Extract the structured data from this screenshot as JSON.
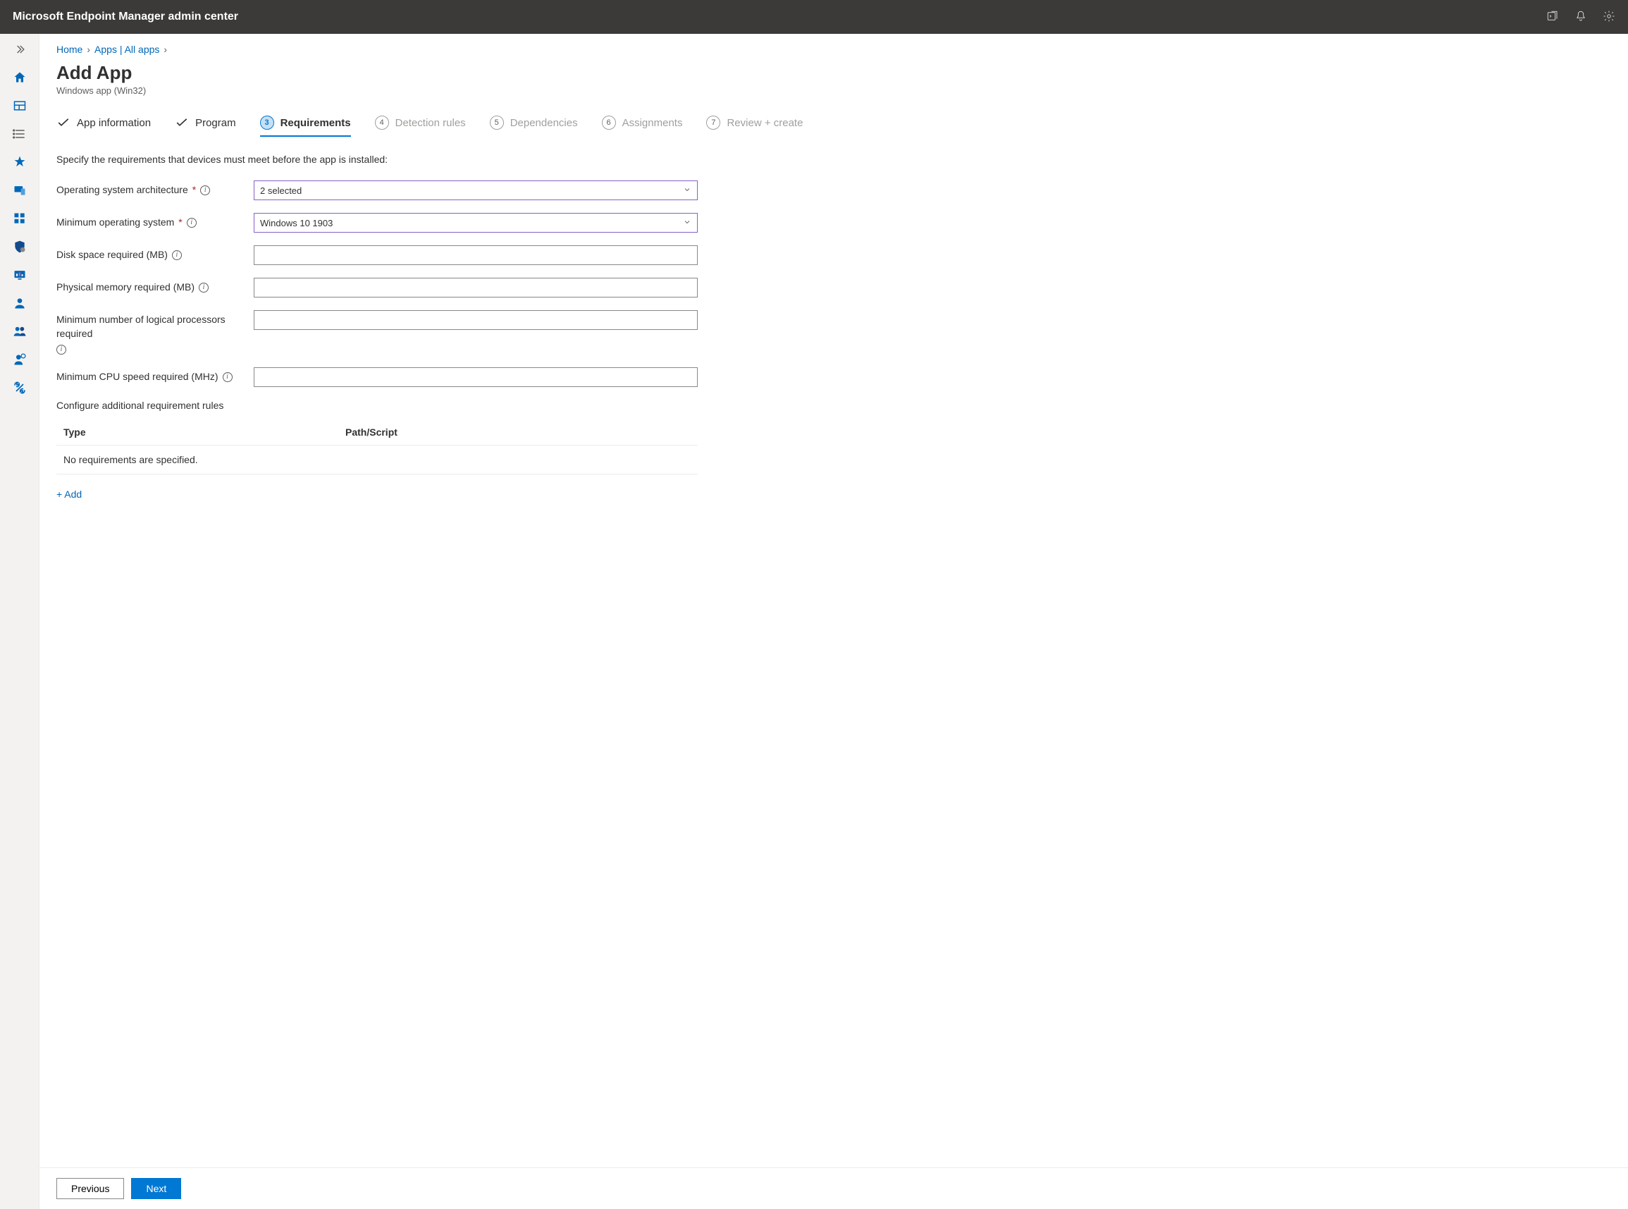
{
  "header": {
    "title": "Microsoft Endpoint Manager admin center"
  },
  "breadcrumb": {
    "home": "Home",
    "apps": "Apps | All apps"
  },
  "page": {
    "title": "Add App",
    "subtitle": "Windows app (Win32)"
  },
  "tabs": {
    "t1": "App information",
    "t2": "Program",
    "t3": "Requirements",
    "t4": "Detection rules",
    "t5": "Dependencies",
    "t6": "Assignments",
    "t7": "Review + create",
    "n3": "3",
    "n4": "4",
    "n5": "5",
    "n6": "6",
    "n7": "7"
  },
  "form": {
    "description": "Specify the requirements that devices must meet before the app is installed:",
    "os_arch_label": "Operating system architecture",
    "os_arch_value": "2 selected",
    "min_os_label": "Minimum operating system",
    "min_os_value": "Windows 10 1903",
    "disk_label": "Disk space required (MB)",
    "disk_value": "",
    "memory_label": "Physical memory required (MB)",
    "memory_value": "",
    "cpu_count_label": "Minimum number of logical processors required",
    "cpu_count_value": "",
    "cpu_speed_label": "Minimum CPU speed required (MHz)",
    "cpu_speed_value": ""
  },
  "rules": {
    "title": "Configure additional requirement rules",
    "col_type": "Type",
    "col_path": "Path/Script",
    "empty": "No requirements are specified.",
    "add": "+ Add"
  },
  "footer": {
    "previous": "Previous",
    "next": "Next"
  }
}
